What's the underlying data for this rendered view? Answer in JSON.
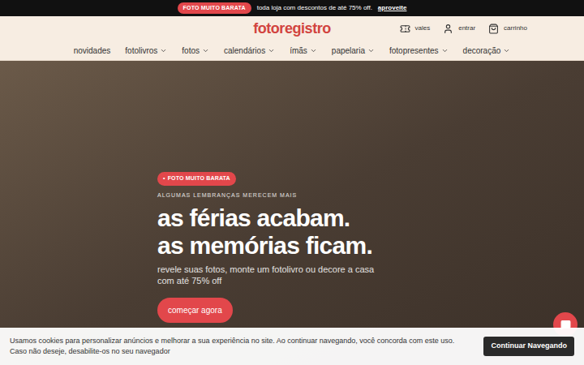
{
  "promo_bar": {
    "badge": "FOTO MUITO BARATA",
    "text": "toda loja com descontos de até 75% off.",
    "link": "aproveite"
  },
  "header": {
    "logo": "fotoregistro",
    "actions": [
      {
        "label": "vales",
        "kind": "voucher"
      },
      {
        "label": "entrar",
        "kind": "user"
      },
      {
        "label": "carrinho",
        "kind": "cart"
      }
    ]
  },
  "nav": [
    {
      "label": "novidades",
      "dropdown": false
    },
    {
      "label": "fotolivros",
      "dropdown": true
    },
    {
      "label": "fotos",
      "dropdown": true
    },
    {
      "label": "calendários",
      "dropdown": true
    },
    {
      "label": "ímãs",
      "dropdown": true
    },
    {
      "label": "papelaria",
      "dropdown": true
    },
    {
      "label": "fotopresentes",
      "dropdown": true
    },
    {
      "label": "decoração",
      "dropdown": true
    }
  ],
  "hero": {
    "badge_icon": "•",
    "badge": "FOTO MUITO BARATA",
    "eyebrow": "ALGUMAS LEMBRANÇAS MERECEM MAIS",
    "headline": [
      "as férias acabam.",
      "as memórias ficam."
    ],
    "subtitle": "revele suas fotos, monte um fotolivro ou decore a casa com até 75% off",
    "button": "começar agora"
  },
  "cookie_bar": {
    "text": "Usamos cookies para personalizar anúncios e melhorar a sua experiência no site. Ao continuar navegando, você concorda com este uso. Caso não deseje, desabilite-os no seu navegador",
    "button": "Continuar Navegando"
  }
}
